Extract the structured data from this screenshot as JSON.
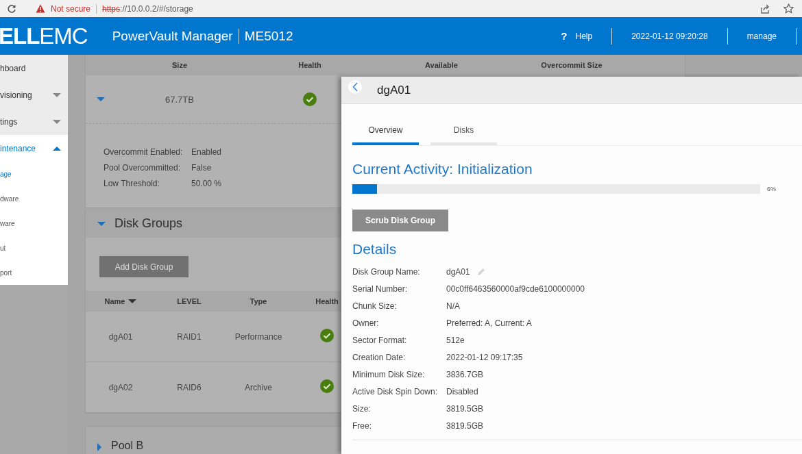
{
  "browser": {
    "security": "Not secure",
    "url_scheme": "https",
    "url_rest": "://10.0.0.2/#/storage"
  },
  "header": {
    "logo_bold": "ELL",
    "logo_light": "EMC",
    "product": "PowerVault Manager",
    "model": "ME5012",
    "help_icon": "?",
    "help": "Help",
    "datetime": "2022-01-12 09:20:28",
    "user": "manage"
  },
  "sidebar": {
    "items": [
      {
        "label": "hboard",
        "kind": "link",
        "selected": false
      },
      {
        "label": "visioning",
        "kind": "group",
        "selected": false,
        "expanded": false
      },
      {
        "label": "tings",
        "kind": "group",
        "selected": false,
        "expanded": false
      },
      {
        "label": "intenance",
        "kind": "group",
        "selected": true,
        "expanded": true,
        "children": [
          {
            "label": "age",
            "selected": true
          },
          {
            "label": "dware",
            "selected": false
          },
          {
            "label": "ware",
            "selected": false
          },
          {
            "label": "ut",
            "selected": false
          },
          {
            "label": "port",
            "selected": false
          }
        ]
      }
    ]
  },
  "pool": {
    "expanded": true,
    "columns": [
      "Size",
      "Health",
      "Available",
      "Overcommit Size"
    ],
    "size": "67.7TB",
    "healthy": true,
    "properties": [
      {
        "label": "Overcommit Enabled:",
        "value": "Enabled"
      },
      {
        "label": "Pool Overcommitted:",
        "value": "False"
      },
      {
        "label": "Low Threshold:",
        "value": "50.00 %"
      }
    ]
  },
  "disk_groups": {
    "title": "Disk Groups",
    "expanded": true,
    "add_button": "Add Disk Group",
    "columns": [
      {
        "label": "Name",
        "sorted": true
      },
      {
        "label": "LEVEL",
        "sorted": false
      },
      {
        "label": "Type",
        "sorted": false
      },
      {
        "label": "Health",
        "sorted": false
      }
    ],
    "rows": [
      {
        "name": "dgA01",
        "raid_level": "RAID1",
        "type": "Performance",
        "healthy": true
      },
      {
        "name": "dgA02",
        "raid_level": "RAID6",
        "type": "Archive",
        "healthy": true
      }
    ]
  },
  "pool_b": {
    "title": "Pool B",
    "expanded": false
  },
  "panel": {
    "title": "dgA01",
    "tabs": [
      {
        "label": "Overview",
        "selected": true
      },
      {
        "label": "Disks",
        "selected": false
      }
    ],
    "activity": "Current Activity: Initialization",
    "progress": {
      "level": 0.06,
      "reading": "6%"
    },
    "scrub_button": "Scrub Disk Group",
    "details_title": "Details",
    "details": [
      {
        "label": "Disk Group Name:",
        "value": "dgA01",
        "editable": true
      },
      {
        "label": "Serial Number:",
        "value": "00c0ff6463560000af9cde6100000000",
        "editable": false
      },
      {
        "label": "Chunk Size:",
        "value": "N/A",
        "editable": false
      },
      {
        "label": "Owner:",
        "value": "Preferred: A, Current: A",
        "editable": false
      },
      {
        "label": "Sector Format:",
        "value": "512e",
        "editable": false
      },
      {
        "label": "Creation Date:",
        "value": "2022-01-12 09:17:35",
        "editable": false
      },
      {
        "label": "Minimum Disk Size:",
        "value": "3836.7GB",
        "editable": false
      },
      {
        "label": "Active Disk Spin Down:",
        "value": "Disabled",
        "editable": false
      },
      {
        "label": "Size:",
        "value": "3819.5GB",
        "editable": false
      },
      {
        "label": "Free:",
        "value": "3819.5GB",
        "editable": false
      }
    ]
  }
}
